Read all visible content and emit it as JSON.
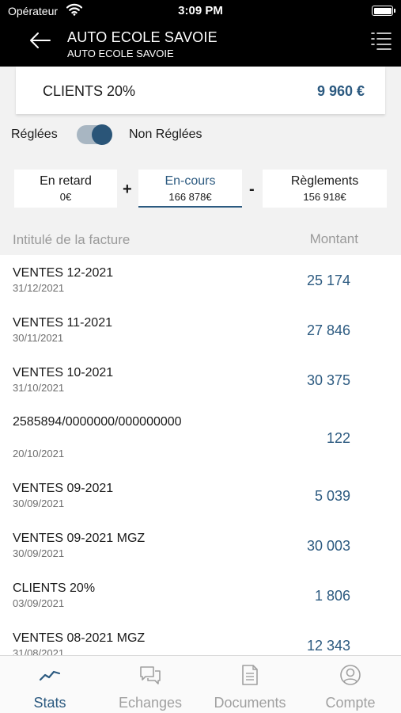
{
  "status": {
    "carrier": "Opérateur",
    "time": "3:09 PM"
  },
  "header": {
    "title": "AUTO ECOLE SAVOIE",
    "subtitle": "AUTO ECOLE SAVOIE"
  },
  "summary": {
    "label": "CLIENTS 20%",
    "amount": "9 960 €"
  },
  "toggle": {
    "left_label": "Réglées",
    "right_label": "Non Réglées",
    "state": "on"
  },
  "filters": [
    {
      "label": "En retard",
      "value": "0€"
    },
    {
      "label": "En-cours",
      "value": "166 878€"
    },
    {
      "label": "Règlements",
      "value": "156 918€"
    }
  ],
  "operators": {
    "plus": "+",
    "minus": "-"
  },
  "list_header": {
    "title": "Intitulé de la facture",
    "amount": "Montant"
  },
  "invoices": [
    {
      "name": "VENTES 12-2021",
      "date": "31/12/2021",
      "amount": "25 174"
    },
    {
      "name": "VENTES 11-2021",
      "date": "30/11/2021",
      "amount": "27 846"
    },
    {
      "name": "VENTES 10-2021",
      "date": "31/10/2021",
      "amount": "30 375"
    },
    {
      "name": "2585894/0000000/000000000",
      "date": "20/10/2021",
      "amount": "122"
    },
    {
      "name": "VENTES 09-2021",
      "date": "30/09/2021",
      "amount": "5 039"
    },
    {
      "name": "VENTES 09-2021 MGZ",
      "date": "30/09/2021",
      "amount": "30 003"
    },
    {
      "name": "CLIENTS 20%",
      "date": "03/09/2021",
      "amount": "1 806"
    },
    {
      "name": "VENTES 08-2021 MGZ",
      "date": "31/08/2021",
      "amount": "12 343"
    }
  ],
  "tabs": [
    {
      "label": "Stats",
      "icon": "chart-line-icon",
      "active": true
    },
    {
      "label": "Echanges",
      "icon": "chat-icon",
      "active": false
    },
    {
      "label": "Documents",
      "icon": "document-icon",
      "active": false
    },
    {
      "label": "Compte",
      "icon": "user-icon",
      "active": false
    }
  ],
  "colors": {
    "accent": "#2c5a80",
    "toggle_track": "#a8b6c2",
    "header_bg": "#000000"
  }
}
